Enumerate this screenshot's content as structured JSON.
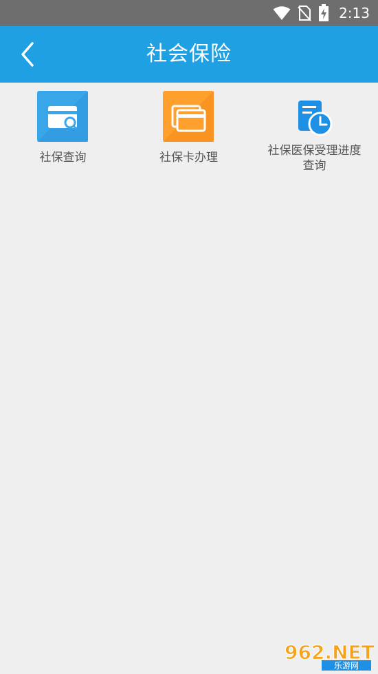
{
  "status_bar": {
    "time": "2:13",
    "icons": [
      "wifi-icon",
      "no-sim-icon",
      "battery-charging-icon"
    ]
  },
  "header": {
    "title": "社会保险",
    "back_icon": "chevron-left-icon"
  },
  "menu": {
    "items": [
      {
        "label": "社保查询",
        "icon": "card-search-icon",
        "color": "#3aa6ea"
      },
      {
        "label": "社保卡办理",
        "icon": "cards-stack-icon",
        "color": "#ff9f2e"
      },
      {
        "label": "社保医保受理进度",
        "label_line2": "查询",
        "icon": "document-clock-icon",
        "color": "#1e90e6"
      }
    ]
  },
  "watermark": {
    "text_top": "962.NET",
    "text_bottom": "乐游网"
  },
  "colors": {
    "header_bg": "#1ea0e2",
    "status_bg": "#6e6e6e",
    "page_bg": "#efefef"
  }
}
